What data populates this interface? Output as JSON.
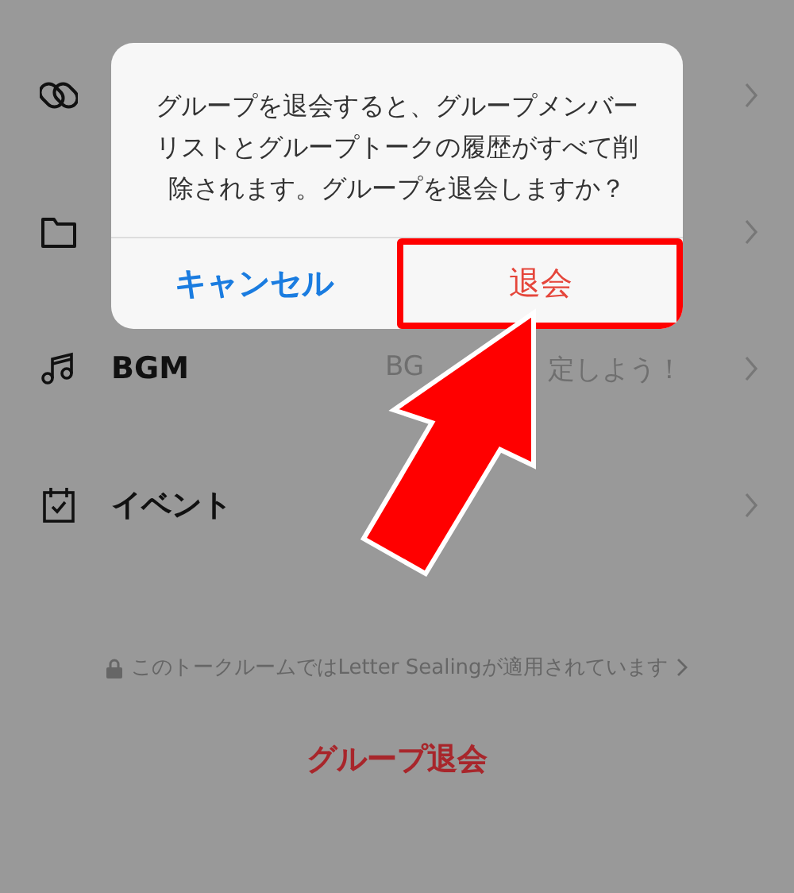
{
  "settings_rows": [
    {
      "kind": "link"
    },
    {
      "kind": "folder"
    },
    {
      "kind": "music",
      "label": "BGM",
      "value_parts": [
        "BG",
        "定しよう！"
      ]
    },
    {
      "kind": "calendar",
      "label": "イベント"
    }
  ],
  "encryption_notice": "このトークルームではLetter Sealingが適用されています",
  "leave_group_button": "グループ退会",
  "dialog": {
    "message": "グループを退会すると、グループメンバーリストとグループトークの履歴がすべて削除されます。グループを退会しますか？",
    "buttons": [
      {
        "label": "キャンセル",
        "kind": "cancel",
        "highlighted": false
      },
      {
        "label": "退会",
        "kind": "destructive",
        "highlighted": true
      }
    ]
  }
}
